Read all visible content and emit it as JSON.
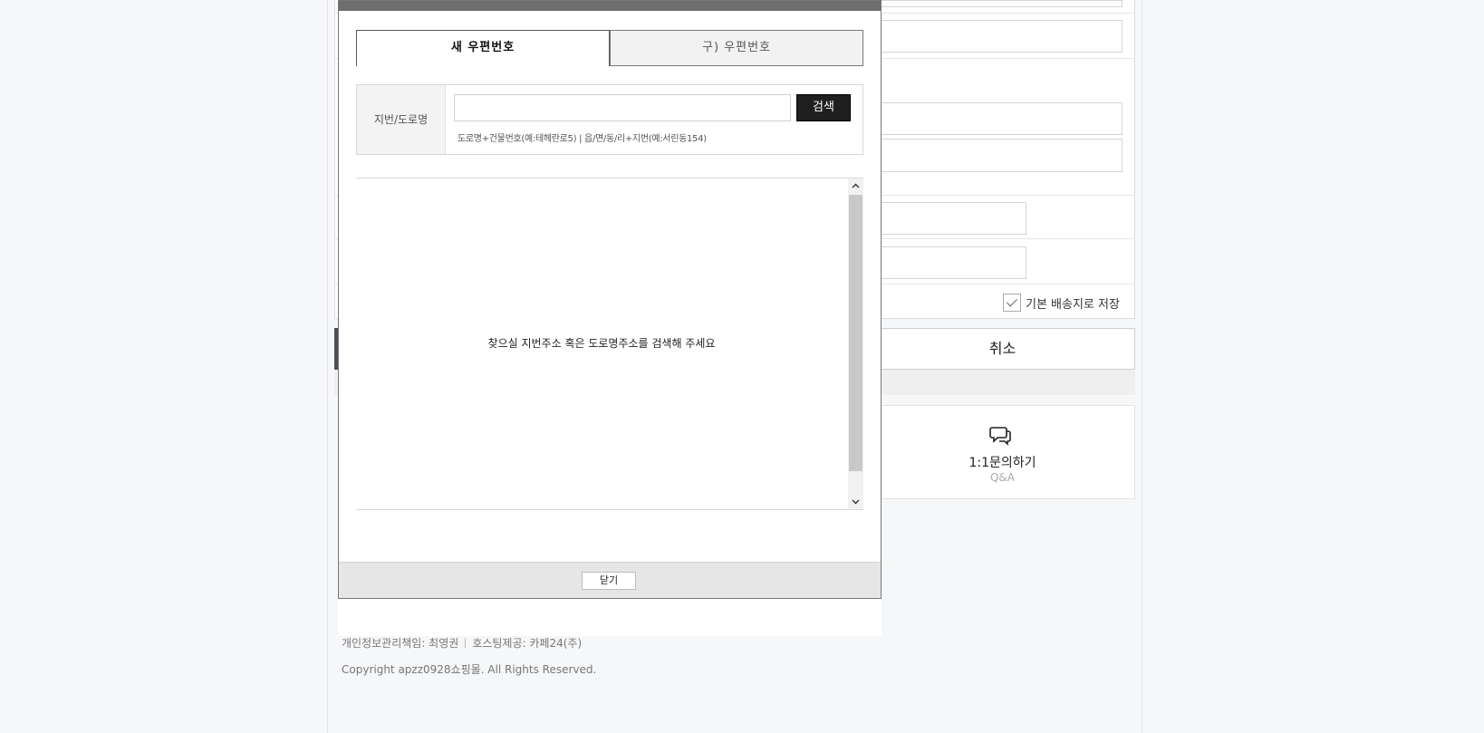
{
  "background": {
    "save_default_label": "기본 배송지로 저장",
    "cancel_label": "취소",
    "qa_title": "1:1문의하기",
    "qa_subtitle": "Q&A",
    "footer_privacy": "개인정보관리책임: 최영권",
    "footer_hosting": "호스팅제공: 카페24(주)",
    "footer_copyright": "Copyright apzz0928쇼핑몰. All Rights Reserved."
  },
  "modal": {
    "tabs": [
      {
        "label": "새 우편번호",
        "active": true
      },
      {
        "label": "구) 우편번호",
        "active": false
      }
    ],
    "search": {
      "label": "지번/도로명",
      "value": "",
      "button_label": "검색",
      "hint": "도로명+건물번호(예:테헤란로5) | 읍/면/동/리+지번(예:서린동154)"
    },
    "results_message": "찾으실 지번주소 혹은 도로명주소를 검색해 주세요",
    "close_label": "닫기"
  },
  "icons": {
    "qa": "chat-bubbles-icon",
    "checkbox": "checkmark-icon",
    "scroll_up": "chevron-up-icon",
    "scroll_down": "chevron-down-icon"
  }
}
